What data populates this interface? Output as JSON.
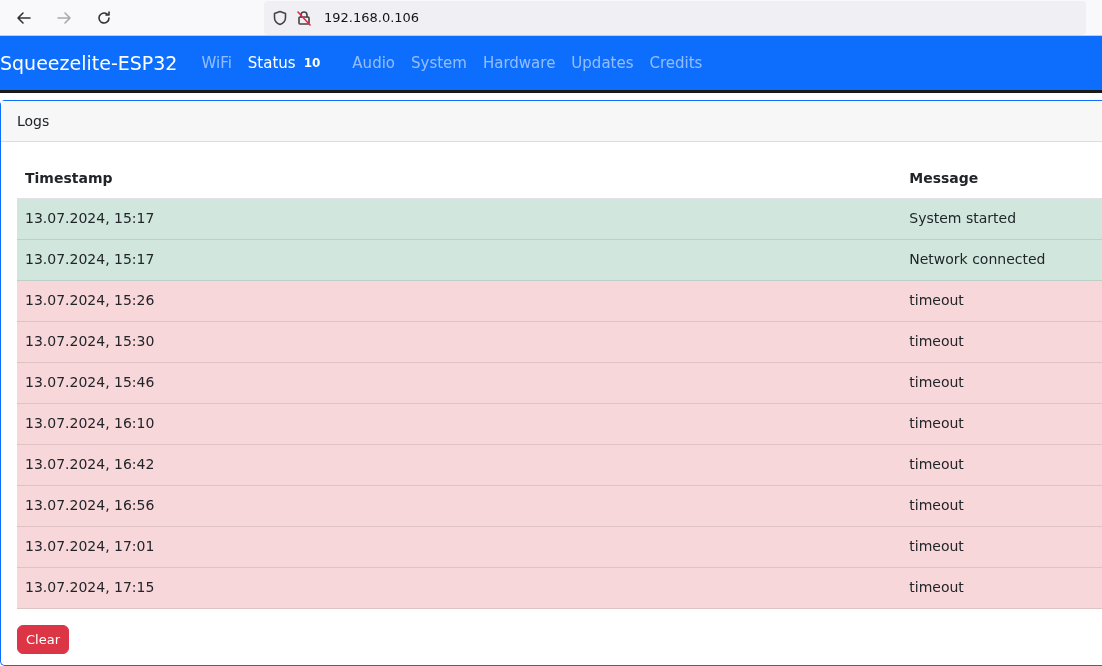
{
  "browser": {
    "address": "192.168.0.106"
  },
  "navbar": {
    "brand": "Squeezelite-ESP32",
    "items": [
      {
        "label": "WiFi",
        "selected": false
      },
      {
        "label": "Status",
        "selected": true,
        "badge": "10"
      },
      {
        "label": "Audio",
        "selected": false
      },
      {
        "label": "System",
        "selected": false
      },
      {
        "label": "Hardware",
        "selected": false
      },
      {
        "label": "Updates",
        "selected": false
      },
      {
        "label": "Credits",
        "selected": false
      }
    ]
  },
  "card": {
    "title": "Logs",
    "table": {
      "columns": [
        "Timestamp",
        "Message"
      ],
      "rows": [
        {
          "kind": "success",
          "cells": [
            "13.07.2024, 15:17",
            "System started"
          ]
        },
        {
          "kind": "success",
          "cells": [
            "13.07.2024, 15:17",
            "Network connected"
          ]
        },
        {
          "kind": "danger",
          "cells": [
            "13.07.2024, 15:26",
            "timeout"
          ]
        },
        {
          "kind": "danger",
          "cells": [
            "13.07.2024, 15:30",
            "timeout"
          ]
        },
        {
          "kind": "danger",
          "cells": [
            "13.07.2024, 15:46",
            "timeout"
          ]
        },
        {
          "kind": "danger",
          "cells": [
            "13.07.2024, 16:10",
            "timeout"
          ]
        },
        {
          "kind": "danger",
          "cells": [
            "13.07.2024, 16:42",
            "timeout"
          ]
        },
        {
          "kind": "danger",
          "cells": [
            "13.07.2024, 16:56",
            "timeout"
          ]
        },
        {
          "kind": "danger",
          "cells": [
            "13.07.2024, 17:01",
            "timeout"
          ]
        },
        {
          "kind": "danger",
          "cells": [
            "13.07.2024, 17:15",
            "timeout"
          ]
        }
      ]
    },
    "button": "Clear"
  }
}
